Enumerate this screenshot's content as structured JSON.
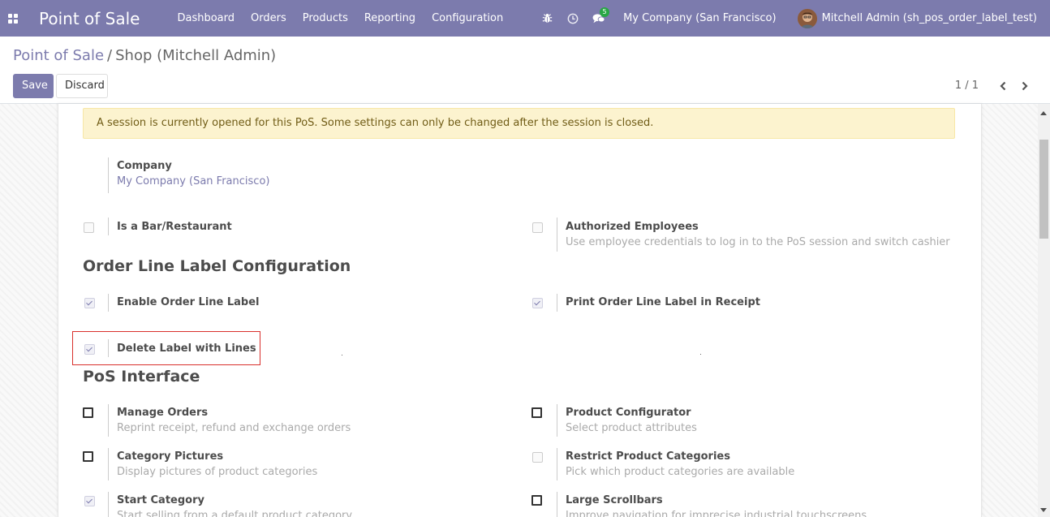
{
  "navbar": {
    "app_title": "Point of Sale",
    "menu": [
      "Dashboard",
      "Orders",
      "Products",
      "Reporting",
      "Configuration"
    ],
    "messages_count": "5",
    "company": "My Company (San Francisco)",
    "user": "Mitchell Admin (sh_pos_order_label_test)",
    "colors": {
      "brand": "#7c7bad"
    }
  },
  "breadcrumb": {
    "root": "Point of Sale",
    "separator": "/",
    "current": "Shop (Mitchell Admin)"
  },
  "actions": {
    "save": "Save",
    "discard": "Discard"
  },
  "pager": {
    "text": "1 / 1"
  },
  "alert": {
    "text": "A session is currently opened for this PoS. Some settings can only be changed after the session is closed."
  },
  "company_field": {
    "label": "Company",
    "value": "My Company (San Francisco)"
  },
  "general": {
    "bar": {
      "label": "Is a Bar/Restaurant",
      "checked": false
    },
    "employees": {
      "label": "Authorized Employees",
      "desc": "Use employee credentials to log in to the PoS session and switch cashier",
      "checked": false
    }
  },
  "order_line_section": {
    "title": "Order Line Label Configuration",
    "enable": {
      "label": "Enable Order Line Label",
      "checked": true
    },
    "print": {
      "label": "Print Order Line Label in Receipt",
      "checked": true
    },
    "delete": {
      "label": "Delete Label with Lines",
      "checked": true
    }
  },
  "pos_interface": {
    "title": "PoS Interface",
    "manage_orders": {
      "label": "Manage Orders",
      "desc": "Reprint receipt, refund and exchange orders",
      "checked": false
    },
    "product_configurator": {
      "label": "Product Configurator",
      "desc": "Select product attributes",
      "checked": false
    },
    "category_pictures": {
      "label": "Category Pictures",
      "desc": "Display pictures of product categories",
      "checked": false
    },
    "restrict_categories": {
      "label": "Restrict Product Categories",
      "desc": "Pick which product categories are available",
      "checked": false
    },
    "start_category": {
      "label": "Start Category",
      "desc": "Start selling from a default product category",
      "checked": true
    },
    "large_scrollbars": {
      "label": "Large Scrollbars",
      "desc": "Improve navigation for imprecise industrial touchscreens",
      "checked": false
    }
  }
}
